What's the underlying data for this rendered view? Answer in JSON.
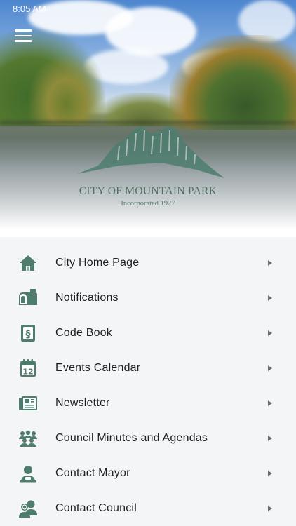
{
  "status_bar": {
    "time": "8:05 AM"
  },
  "header": {
    "menu_icon": "hamburger-icon",
    "logo_title": "CITY OF MOUNTAIN PARK",
    "logo_subtitle": "Incorporated 1927"
  },
  "colors": {
    "accent": "#4e7d6e",
    "background": "#f4f5f6",
    "text": "#1f1f1f",
    "chevron": "#6d6d6d"
  },
  "menu": {
    "items": [
      {
        "label": "City Home Page",
        "icon": "home-icon"
      },
      {
        "label": "Notifications",
        "icon": "mailbox-icon"
      },
      {
        "label": "Code Book",
        "icon": "law-book-icon"
      },
      {
        "label": "Events Calendar",
        "icon": "calendar-icon"
      },
      {
        "label": "Newsletter",
        "icon": "newspaper-icon"
      },
      {
        "label": "Council Minutes and Agendas",
        "icon": "group-icon"
      },
      {
        "label": "Contact Mayor",
        "icon": "person-icon"
      },
      {
        "label": "Contact Council",
        "icon": "council-members-icon"
      }
    ]
  }
}
